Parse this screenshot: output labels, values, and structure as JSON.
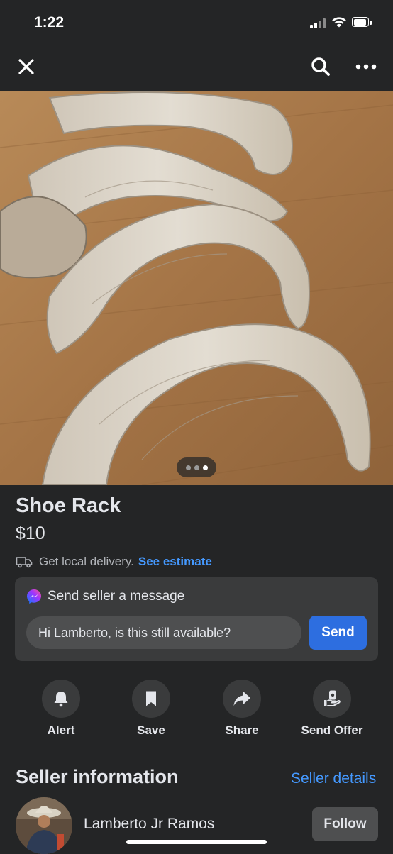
{
  "status_bar": {
    "time": "1:22"
  },
  "nav": {
    "close_icon": "close-icon",
    "search_icon": "search-icon",
    "more_icon": "more-horizontal-icon"
  },
  "photo": {
    "pager_total": 3,
    "pager_active": 3
  },
  "listing": {
    "title": "Shoe Rack",
    "price": "$10",
    "delivery_text": "Get local delivery.",
    "delivery_link": "See estimate"
  },
  "message": {
    "header": "Send seller a message",
    "input_value": "Hi Lamberto, is this still available?",
    "send_label": "Send"
  },
  "actions": [
    {
      "label": "Alert",
      "icon": "bell-icon"
    },
    {
      "label": "Save",
      "icon": "bookmark-icon"
    },
    {
      "label": "Share",
      "icon": "share-arrow-icon"
    },
    {
      "label": "Send Offer",
      "icon": "offer-hand-icon"
    }
  ],
  "seller": {
    "heading": "Seller information",
    "details_link": "Seller details",
    "name": "Lamberto Jr Ramos",
    "follow_label": "Follow"
  },
  "colors": {
    "background": "#242526",
    "card": "#3a3b3c",
    "accent_blue": "#2d6ee0",
    "link_blue": "#4599ff",
    "text_primary": "#e4e6eb",
    "text_secondary": "#b0b3b8"
  }
}
